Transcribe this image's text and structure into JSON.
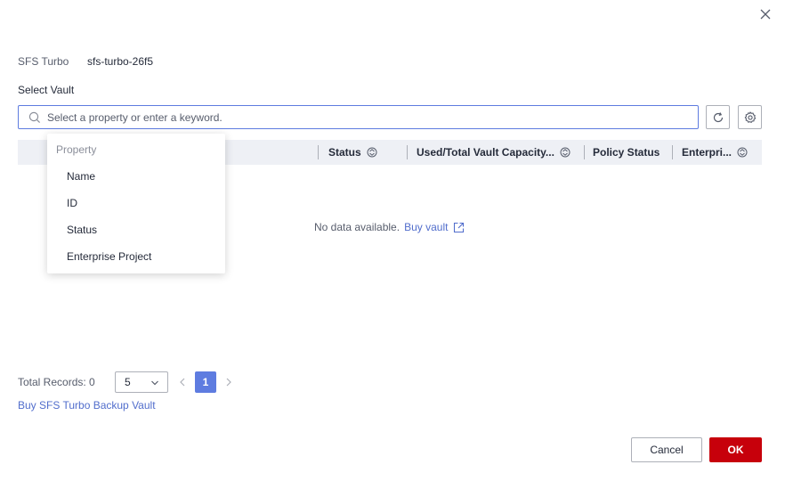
{
  "dialog": {
    "close_icon": "close-icon"
  },
  "sfs": {
    "label": "SFS Turbo",
    "value": "sfs-turbo-26f5"
  },
  "select_vault": {
    "label": "Select Vault",
    "search_placeholder": "Select a property or enter a keyword.",
    "search_value": ""
  },
  "table": {
    "columns": [
      {
        "label": "Status"
      },
      {
        "label": "Used/Total Vault Capacity..."
      },
      {
        "label": "Policy Status"
      },
      {
        "label": "Enterpri..."
      }
    ],
    "empty": {
      "message": "No data available.",
      "link": "Buy vault"
    }
  },
  "property_dropdown": {
    "title": "Property",
    "items": [
      "Name",
      "ID",
      "Status",
      "Enterprise Project"
    ]
  },
  "pagination": {
    "total_label": "Total Records: 0",
    "page_size": "5",
    "current_page": "1"
  },
  "buy_backup_link": "Buy SFS Turbo Backup Vault",
  "footer": {
    "cancel_label": "Cancel",
    "ok_label": "OK"
  },
  "colors": {
    "accent": "#5e7ce0",
    "link": "#526ecc",
    "primary_button": "#c7000b",
    "table_header_bg": "#eef0f5"
  }
}
